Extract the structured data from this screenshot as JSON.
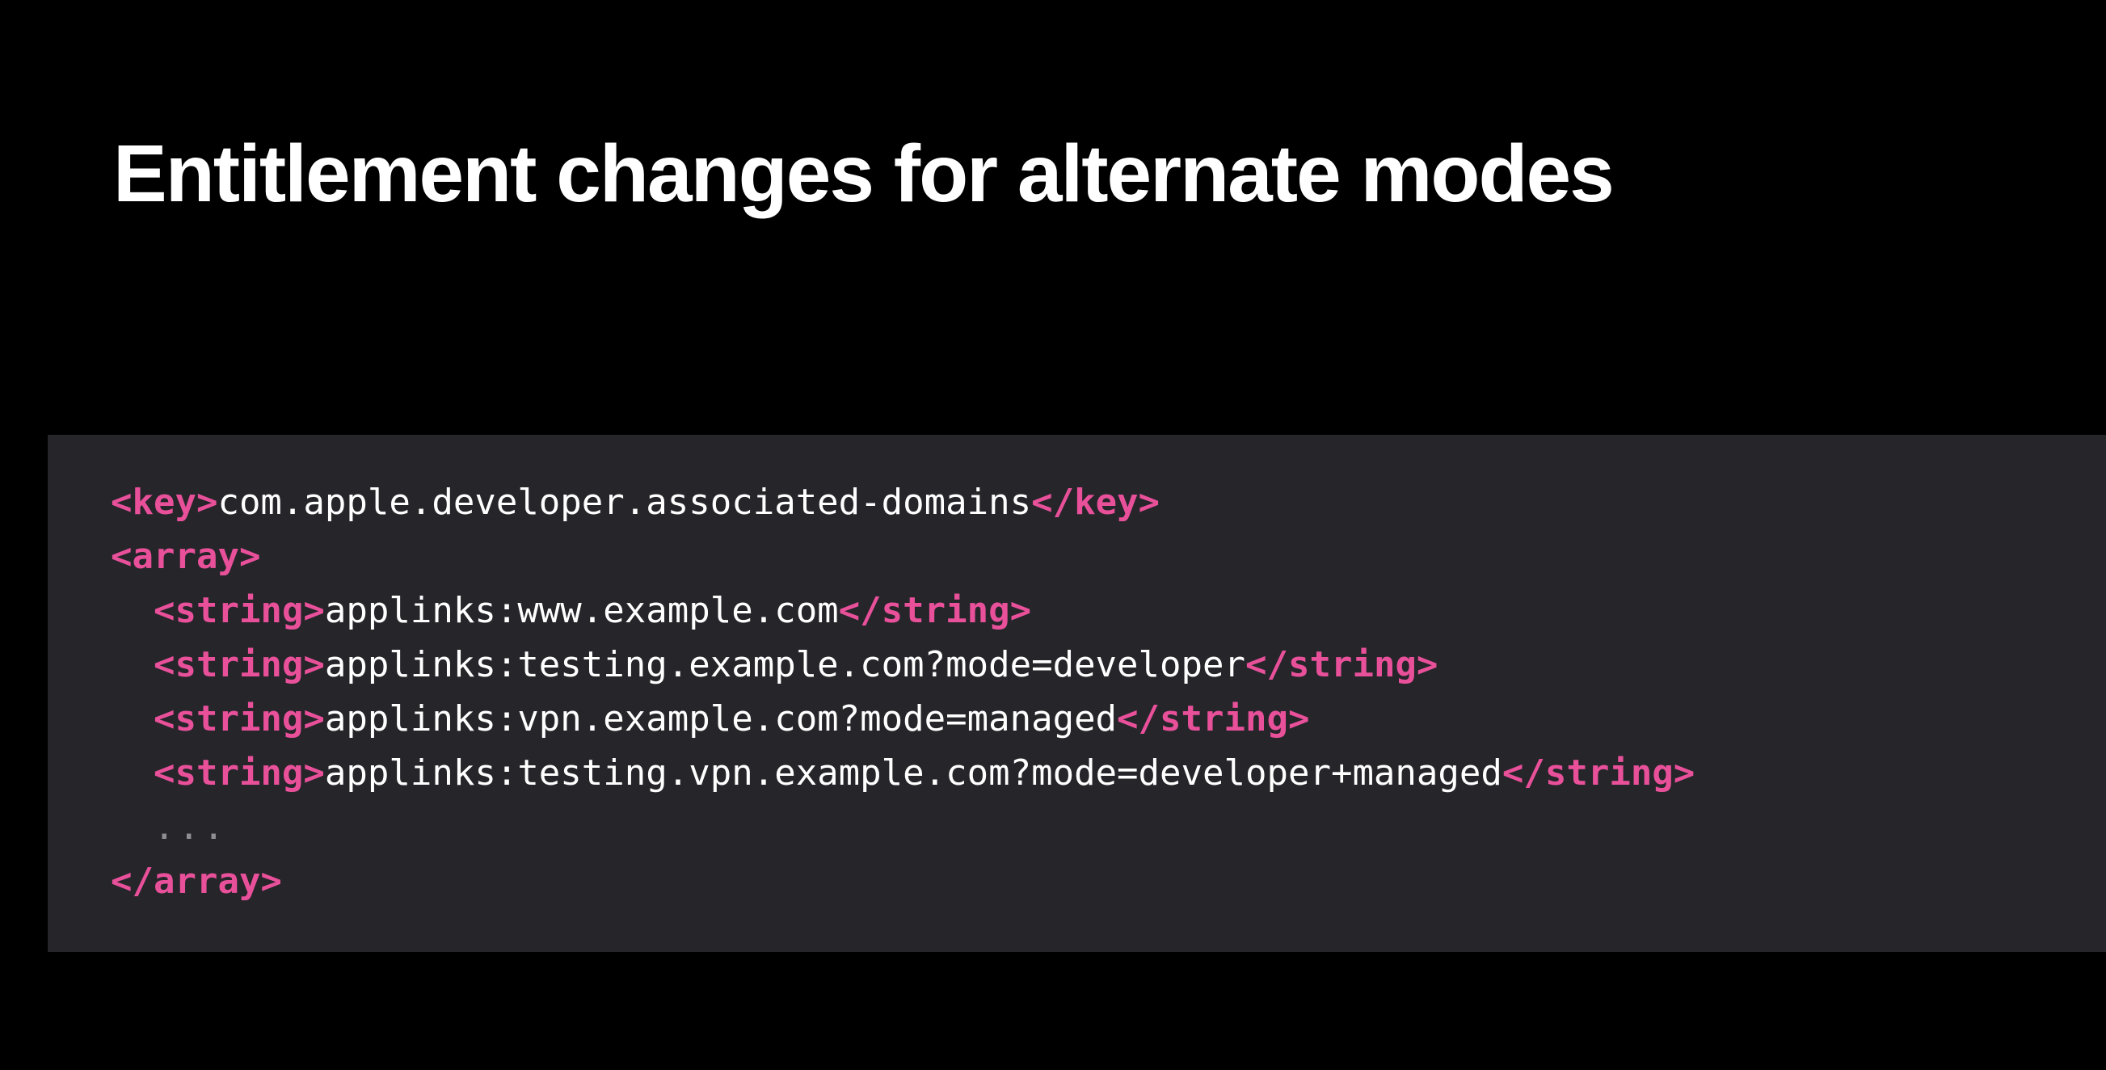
{
  "slide": {
    "title": "Entitlement changes for alternate modes"
  },
  "colors": {
    "background": "#000000",
    "code_panel": "#25252a",
    "tag": "#e8509a",
    "text": "#ffffff",
    "ellipsis": "#8e8e93"
  },
  "code": {
    "lines": [
      {
        "indent": "",
        "open_tag": "<key>",
        "content": "com.apple.developer.associated-domains",
        "close_tag": "</key>"
      },
      {
        "indent": "",
        "open_tag": "<array>",
        "content": "",
        "close_tag": ""
      },
      {
        "indent": "  ",
        "open_tag": "<string>",
        "content": "applinks:www.example.com",
        "close_tag": "</string>"
      },
      {
        "indent": "  ",
        "open_tag": "<string>",
        "content": "applinks:testing.example.com?mode=developer",
        "close_tag": "</string>"
      },
      {
        "indent": "  ",
        "open_tag": "<string>",
        "content": "applinks:vpn.example.com?mode=managed",
        "close_tag": "</string>"
      },
      {
        "indent": "  ",
        "open_tag": "<string>",
        "content": "applinks:testing.vpn.example.com?mode=developer+managed",
        "close_tag": "</string>"
      },
      {
        "indent": "  ",
        "ellipsis": "..."
      },
      {
        "indent": "",
        "open_tag": "</array>",
        "content": "",
        "close_tag": ""
      }
    ]
  }
}
